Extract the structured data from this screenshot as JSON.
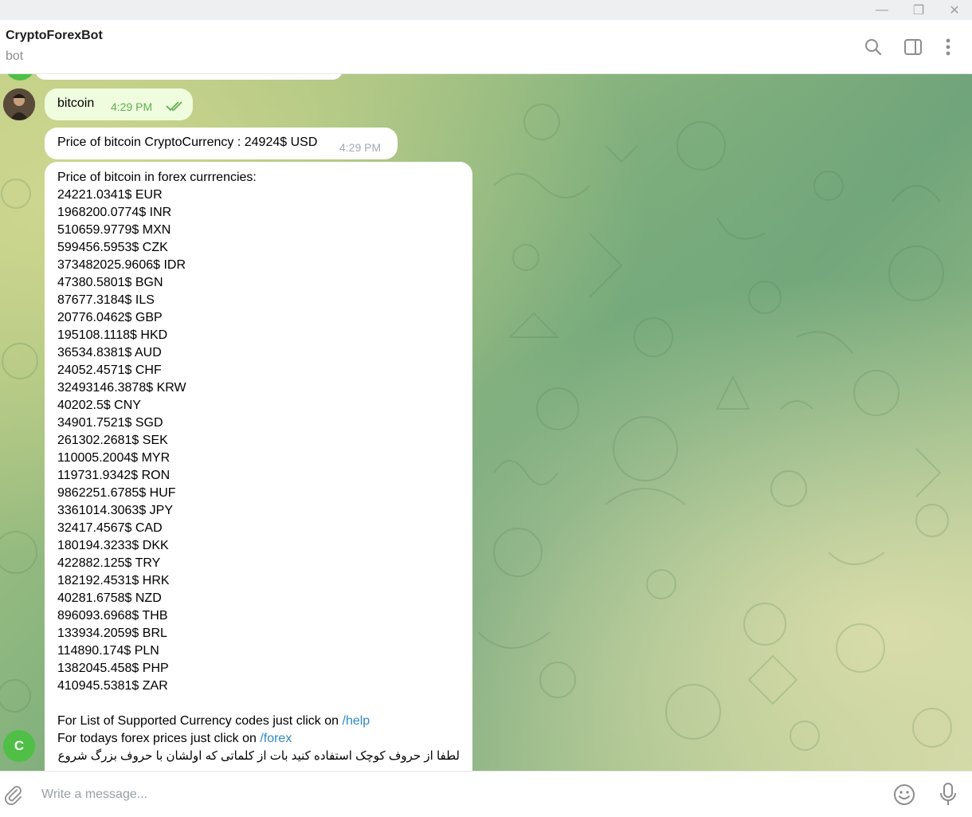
{
  "window": {
    "minimize_glyph": "—",
    "restore_glyph": "❐",
    "close_glyph": "✕"
  },
  "header": {
    "title": "CryptoForexBot",
    "subtitle": "bot",
    "icons": [
      "search-icon",
      "sidebar-toggle-icon",
      "more-vert-icon"
    ]
  },
  "messages": {
    "user_message": {
      "text": "bitcoin",
      "time": "4:29 PM"
    },
    "price_message": {
      "text": "Price of bitcoin CryptoCurrency : 24924$ USD",
      "time": "4:29 PM"
    },
    "forex_message": {
      "heading": "Price of bitcoin in forex currrencies:",
      "rates": [
        "24221.0341$ EUR",
        "1968200.0774$ INR",
        "510659.9779$ MXN",
        "599456.5953$ CZK",
        "373482025.9606$ IDR",
        "47380.5801$ BGN",
        "87677.3184$ ILS",
        "20776.0462$ GBP",
        "195108.1118$ HKD",
        "36534.8381$ AUD",
        "24052.4571$ CHF",
        "32493146.3878$ KRW",
        "40202.5$ CNY",
        "34901.7521$ SGD",
        "261302.2681$ SEK",
        "110005.2004$ MYR",
        "119731.9342$ RON",
        "9862251.6785$ HUF",
        "3361014.3063$ JPY",
        "32417.4567$ CAD",
        "180194.3233$ DKK",
        "422882.125$ TRY",
        "182192.4531$ HRK",
        "40281.6758$ NZD",
        "896093.6968$ THB",
        "133934.2059$ BRL",
        "114890.174$ PLN",
        "1382045.458$ PHP",
        "410945.5381$ ZAR"
      ],
      "help_prefix": "For List of Supported Currency codes just click on ",
      "help_link": "/help",
      "forex_prefix": "For todays forex prices just click on ",
      "forex_link": "/forex",
      "persian_note": "لطفا از حروف کوچک استفاده کنید بات از کلماتی که اولشان با حروف بزرگ شروع"
    }
  },
  "avatars": {
    "bot_initial": "C",
    "bot_color": "#4fbf45"
  },
  "composer": {
    "placeholder": "Write a message..."
  },
  "colors": {
    "outgoing_bubble": "#effdde",
    "incoming_bubble": "#ffffff",
    "link": "#2f89c5",
    "read_check": "#5dae52"
  }
}
